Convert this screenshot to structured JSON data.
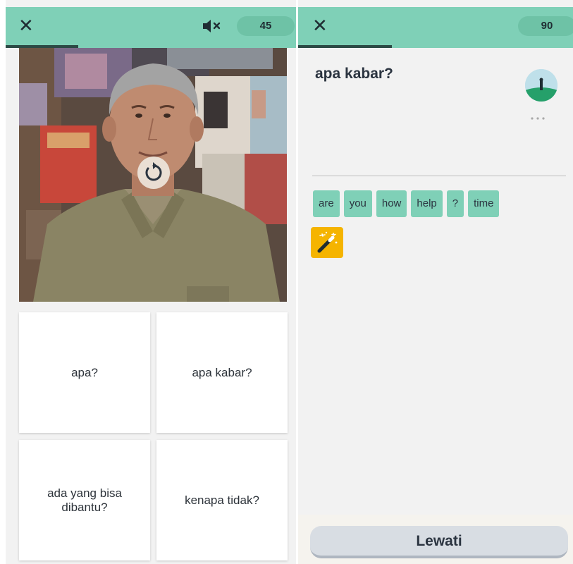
{
  "left": {
    "close_icon": "close-icon",
    "mute_icon": "speaker-muted-icon",
    "score": "45",
    "progress": 0.25,
    "replay_icon": "replay-icon",
    "options": [
      "apa?",
      "apa kabar?",
      "ada yang bisa dibantu?",
      "kenapa tidak?"
    ]
  },
  "right": {
    "close_icon": "close-icon",
    "score": "90",
    "progress": 0.34,
    "prompt": "apa kabar?",
    "more_icon": "more-dots-icon",
    "word_bank": [
      "are",
      "you",
      "how",
      "help",
      "?",
      "time"
    ],
    "hint_icon": "magic-wand-icon",
    "skip_label": "Lewati"
  },
  "colors": {
    "header_green": "#7fd0b7",
    "pill_green": "#6ec2a6",
    "hint_yellow": "#f5b400",
    "progress_dark": "#2c4a45"
  }
}
